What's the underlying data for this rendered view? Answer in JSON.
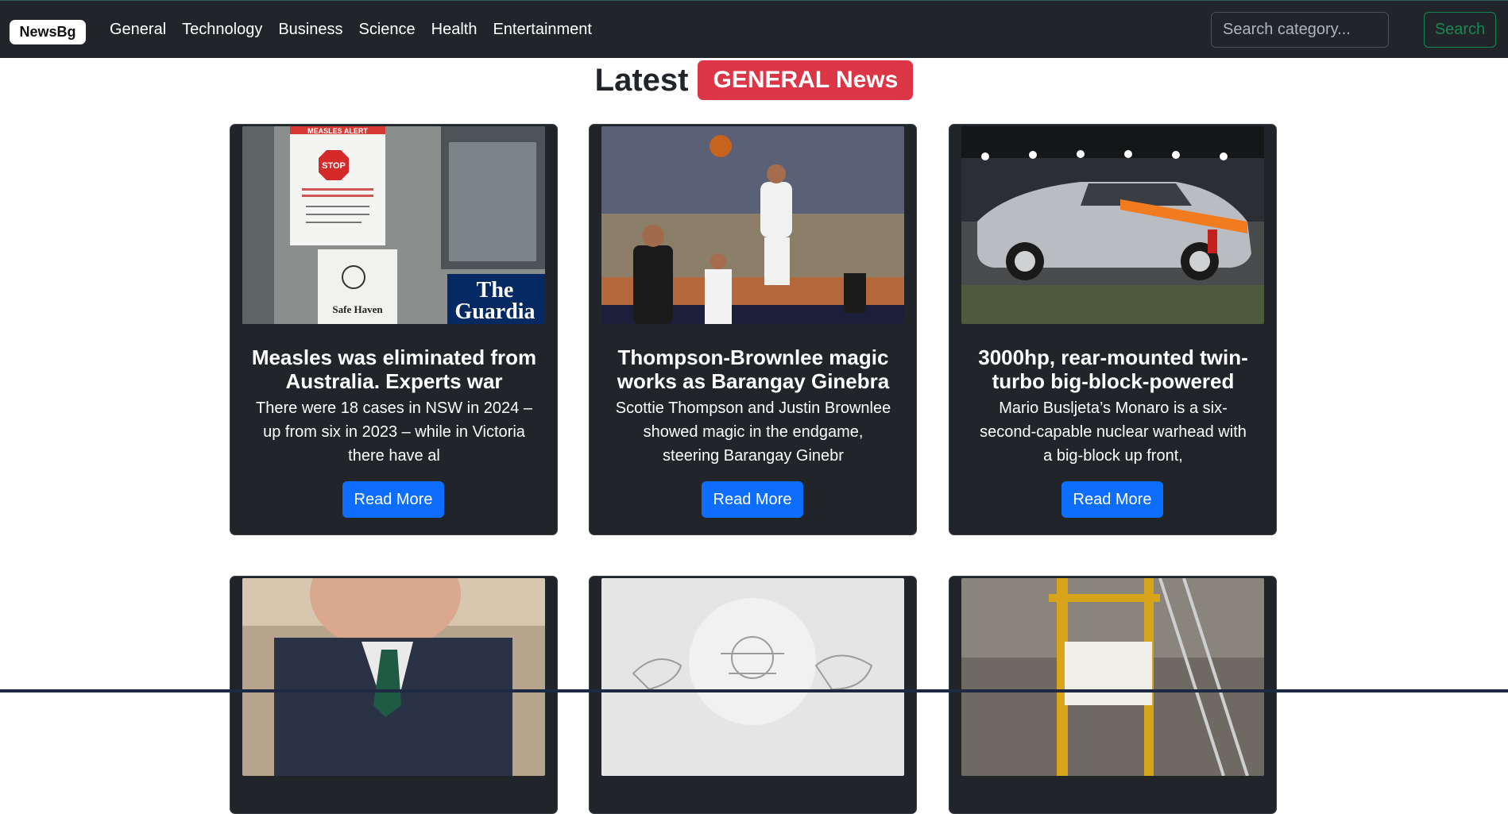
{
  "navbar": {
    "brand": "NewsBg",
    "links": [
      "General",
      "Technology",
      "Business",
      "Science",
      "Health",
      "Entertainment"
    ],
    "search_placeholder": "Search category...",
    "search_button": "Search"
  },
  "heading": {
    "prefix": "Latest",
    "badge": "GENERAL News"
  },
  "cards": [
    {
      "title": "Measles was eliminated from Australia. Experts war",
      "description": "There were 18 cases in NSW in 2024 – up from six in 2023 – while in Victoria there have al",
      "button": "Read More",
      "image_overlay": [
        "The",
        "Guardia"
      ],
      "sign_alert": "MEASLES ALERT",
      "sign_stop": "STOP",
      "sign_haven": "Safe Haven"
    },
    {
      "title": "Thompson-Brownlee magic works as Barangay Ginebra",
      "description": "Scottie Thompson and Justin Brownlee showed magic in the endgame, steering Barangay Ginebr",
      "button": "Read More"
    },
    {
      "title": "3000hp, rear-mounted twin-turbo big-block-powered",
      "description": "Mario Busljeta’s Monaro is a six-second-capable nuclear warhead with a big-block up front,",
      "button": "Read More"
    }
  ],
  "colors": {
    "navbar": "#212529",
    "badge": "#dc3545",
    "read_more": "#0d6efd",
    "search_button": "#198754",
    "card": "#212529"
  }
}
